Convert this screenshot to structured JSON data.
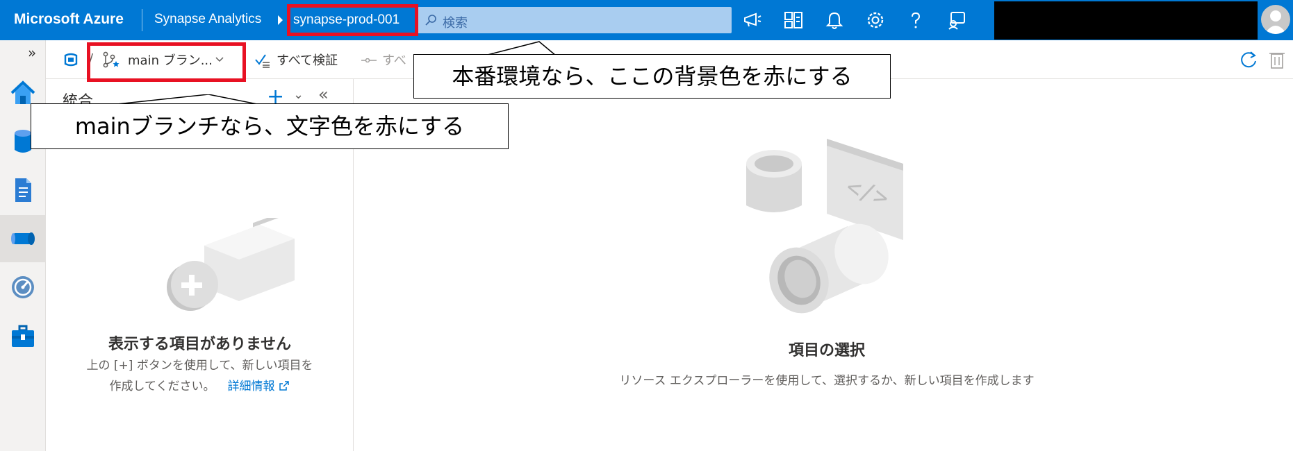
{
  "header": {
    "brand": "Microsoft Azure",
    "product": "Synapse Analytics",
    "workspace": "synapse-prod-001",
    "search_placeholder": "検索",
    "icons": [
      "megaphone-icon",
      "portal-icon",
      "bell-icon",
      "gear-icon",
      "help-icon",
      "feedback-icon"
    ]
  },
  "commandbar": {
    "branch": "main ブラン...",
    "validate_all": "すべて検証",
    "publish_all": "すべ"
  },
  "left_pane": {
    "title": "統合",
    "empty_title": "表示する項目がありません",
    "empty_line1": "上の [+] ボタンを使用して、新しい項目を",
    "empty_line2": "作成してください。",
    "empty_link": "詳細情報"
  },
  "main": {
    "title": "項目の選択",
    "subtitle": "リソース エクスプローラーを使用して、選択するか、新しい項目を作成します"
  },
  "annotations": {
    "callout_env": "本番環境なら、ここの背景色を赤にする",
    "callout_branch": "mainブランチなら、文字色を赤にする",
    "highlight_color": "#e81123"
  },
  "colors": {
    "topbar": "#0078d4",
    "accent": "#0078d4"
  }
}
